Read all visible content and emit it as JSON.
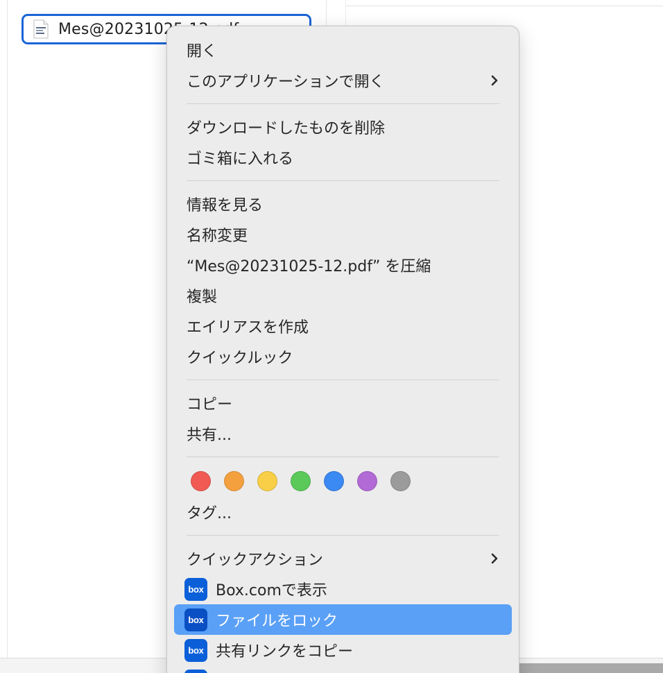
{
  "file": {
    "name": "Mes@20231025-12.pdf"
  },
  "menu": {
    "items": {
      "open": "開く",
      "open_with": "このアプリケーションで開く",
      "delete_downloaded": "ダウンロードしたものを削除",
      "move_to_trash": "ゴミ箱に入れる",
      "get_info": "情報を見る",
      "rename": "名称変更",
      "compress": "“Mes@20231025-12.pdf” を圧縮",
      "duplicate": "複製",
      "make_alias": "エイリアスを作成",
      "quick_look": "クイックルック",
      "copy": "コピー",
      "share": "共有...",
      "tags": "タグ...",
      "quick_actions": "クイックアクション",
      "box_show": "Box.comで表示",
      "box_lock": "ファイルをロック",
      "box_copy_link": "共有リンクをコピー"
    },
    "box_icon_text": "box",
    "tag_colors": [
      {
        "name": "red",
        "color": "#f05a52"
      },
      {
        "name": "orange",
        "color": "#f5a03e"
      },
      {
        "name": "yellow",
        "color": "#f8cf47"
      },
      {
        "name": "green",
        "color": "#5ac95a"
      },
      {
        "name": "blue",
        "color": "#3b89f2"
      },
      {
        "name": "purple",
        "color": "#b26ad6"
      },
      {
        "name": "gray",
        "color": "#9b9b9b"
      }
    ],
    "highlight_color": "#5aa0f6"
  }
}
